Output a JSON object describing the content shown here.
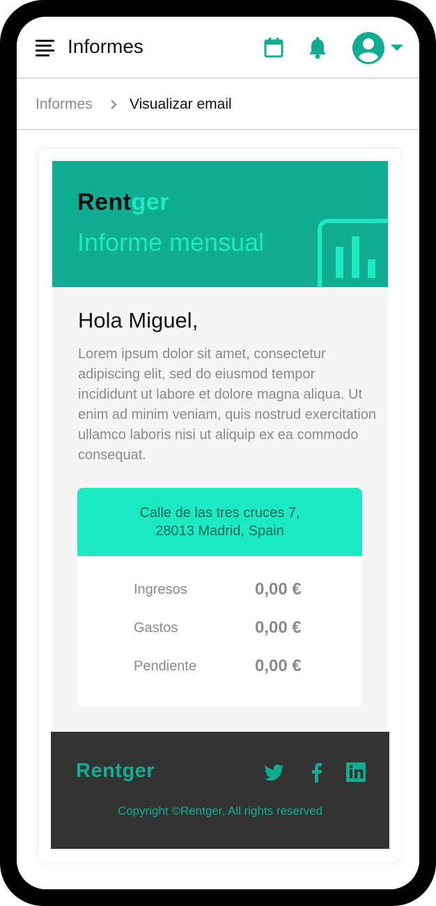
{
  "header": {
    "title": "Informes",
    "icons": [
      "menu-icon",
      "calendar-icon",
      "bell-icon",
      "user-avatar-icon",
      "chevron-down-icon"
    ]
  },
  "breadcrumb": {
    "items": [
      "Informes",
      "Visualizar email"
    ]
  },
  "email": {
    "banner": {
      "brand_part1": "Rent",
      "brand_part2": "ger",
      "title": "Informe mensual",
      "icon": "bar-chart-icon"
    },
    "greeting": "Hola Miguel,",
    "intro": "Lorem ipsum dolor sit amet, consectetur adipiscing elit, sed do eiusmod tempor incididunt ut labore et dolore magna aliqua. Ut enim ad minim veniam, quis nostrud exercitation ullamco laboris nisi ut aliquip ex ea commodo consequat.",
    "summary": {
      "address_line1": "Calle de las tres cruces 7,",
      "address_line2": "28013 Madrid, Spain",
      "rows": [
        {
          "label": "Ingresos",
          "value": "0,00 €"
        },
        {
          "label": "Gastos",
          "value": "0,00 €"
        },
        {
          "label": "Pendiente",
          "value": "0,00 €"
        }
      ]
    },
    "footer": {
      "brand": "Rentger",
      "social_icons": [
        "twitter-icon",
        "facebook-icon",
        "linkedin-icon"
      ],
      "copyright": "Copyright  ©Rentger, All rights reserved"
    }
  },
  "colors": {
    "primary": "#11ad92",
    "accent": "#1de9c5",
    "footer_bg": "#333333",
    "body_bg": "#f5f5f5",
    "muted_text": "#8a8a8a"
  }
}
